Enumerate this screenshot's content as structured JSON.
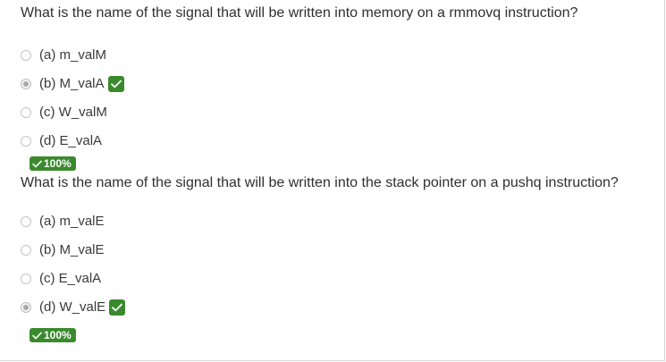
{
  "questions": [
    {
      "text": "What is the name of the signal that will be written into memory on a rmmovq instruction?",
      "options": [
        {
          "label": "(a) m_valM",
          "selected": false
        },
        {
          "label": "(b) M_valA",
          "selected": true,
          "correct": true
        },
        {
          "label": "(c) W_valM",
          "selected": false
        },
        {
          "label": "(d) E_valA",
          "selected": false
        }
      ],
      "score": "100%"
    },
    {
      "text": "What is the name of the signal that will be written into the stack pointer on a pushq instruction?",
      "options": [
        {
          "label": "(a) m_valE",
          "selected": false
        },
        {
          "label": "(b) M_valE",
          "selected": false
        },
        {
          "label": "(c) E_valA",
          "selected": false
        },
        {
          "label": "(d) W_valE",
          "selected": true,
          "correct": true
        }
      ],
      "score": "100%"
    }
  ],
  "colors": {
    "accent_green": "#3a8a2d",
    "radio_border": "#c4c4c4",
    "text": "#2f2f2f"
  },
  "icons": {
    "correct": "check-icon",
    "radio": "radio-button"
  }
}
